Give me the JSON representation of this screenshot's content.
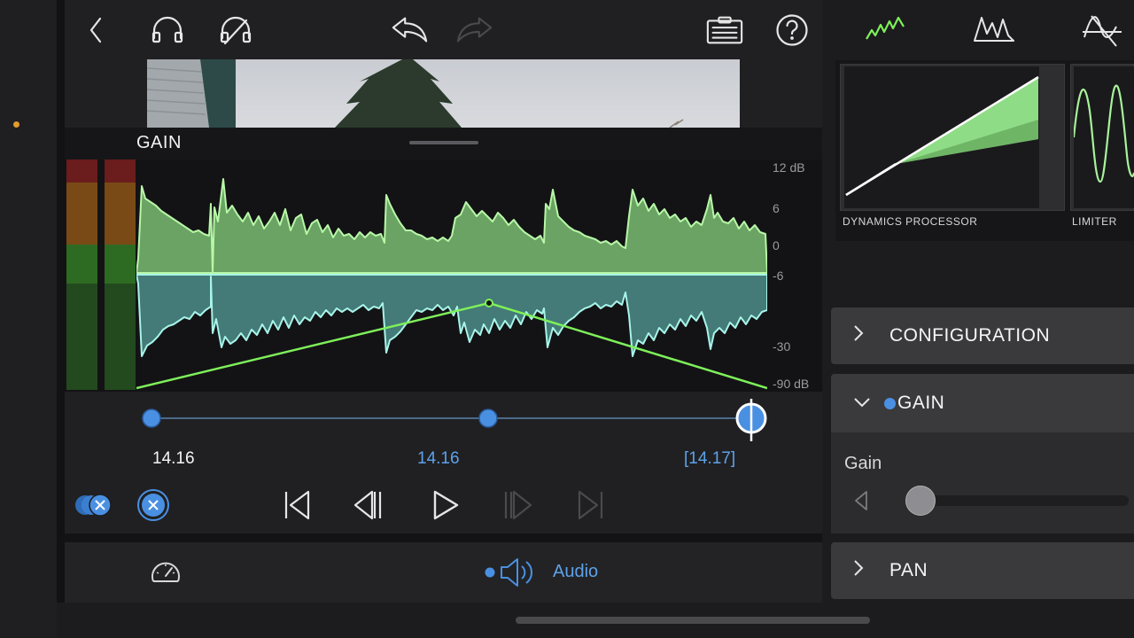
{
  "toolbar": {
    "icons": [
      "back-icon",
      "headphones-icon",
      "headphones-muted-icon",
      "undo-icon",
      "redo-icon",
      "clipboard-icon",
      "help-icon"
    ]
  },
  "panel": {
    "title": "GAIN",
    "db_scale": [
      "12 dB",
      "6",
      "0",
      "-6",
      "-30",
      "-90 dB"
    ]
  },
  "timeline": {
    "start_time": "14.16",
    "mid_time": "14.16",
    "end_time": "[14.17]"
  },
  "bottom": {
    "audio_label": "Audio"
  },
  "inspector": {
    "plugins": [
      {
        "label": "DYNAMICS PROCESSOR",
        "icon": "dynamics-icon"
      },
      {
        "label": "LIMITER",
        "icon": "limiter-icon"
      }
    ],
    "sections": {
      "configuration": "CONFIGURATION",
      "gain": "GAIN",
      "pan": "PAN"
    },
    "gain_param_label": "Gain",
    "gain_value_fraction": 0.0
  },
  "colors": {
    "accent_blue": "#4a90e2",
    "wave_green": "#a8f39a",
    "wave_cyan": "#9ff1e4",
    "envelope_green": "#7ef05a",
    "meter_red": "#6b1c1c",
    "meter_orange": "#7a4a16",
    "meter_green": "#2d6b22"
  }
}
